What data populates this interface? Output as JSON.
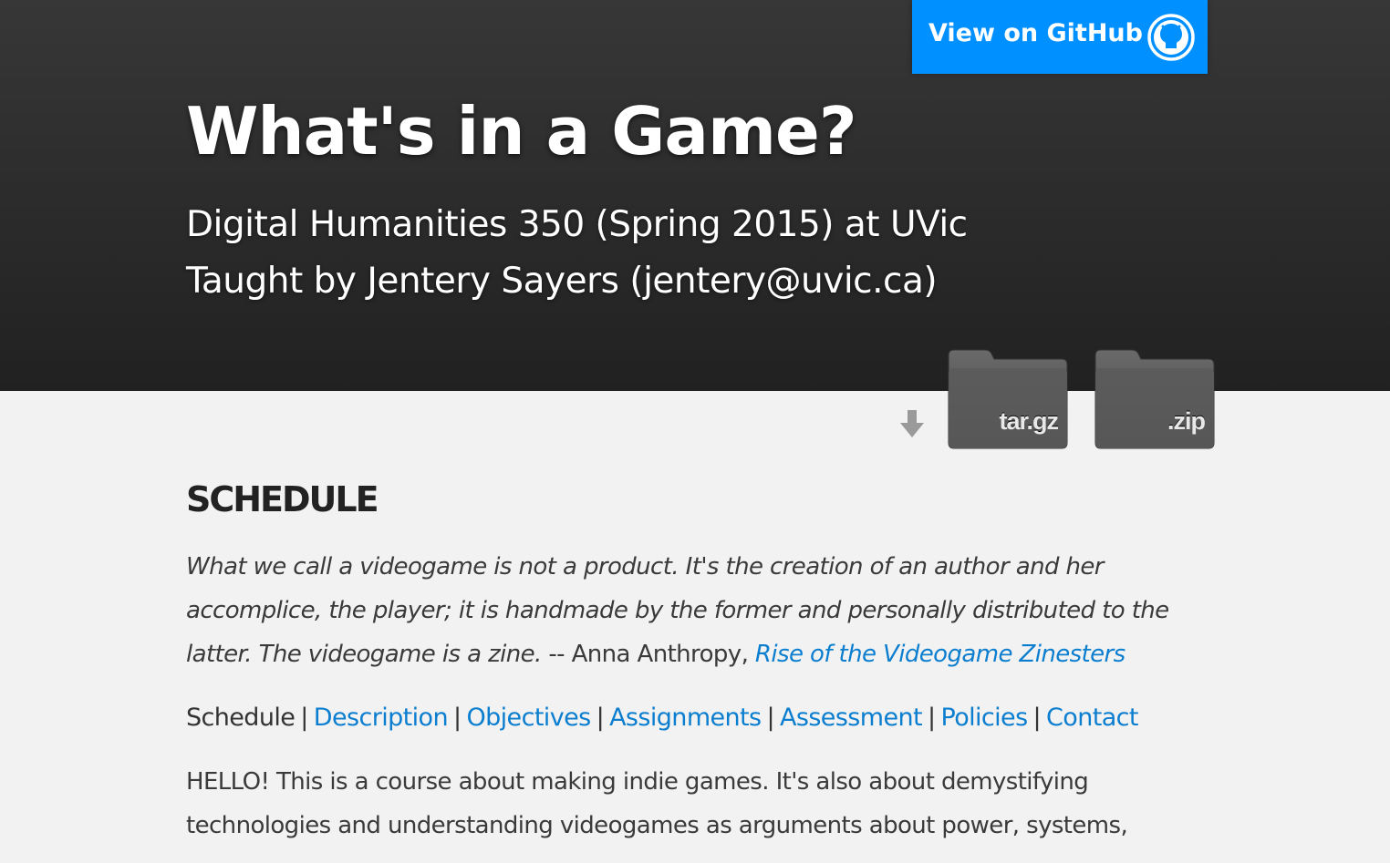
{
  "header": {
    "github_button_label": "View on GitHub",
    "github_icon": "github-octocat-icon",
    "title": "What's in a Game?",
    "subtitle_line1": "Digital Humanities 350 (Spring 2015) at UVic",
    "subtitle_line2": "Taught by Jentery Sayers (jentery@uvic.ca)"
  },
  "downloads": {
    "arrow_icon": "download-arrow-icon",
    "tar_label": "tar.gz",
    "zip_label": ".zip"
  },
  "main": {
    "heading": "SCHEDULE",
    "quote_text": "What we call a videogame is not a product. It's the creation of an author and her accomplice, the player; it is handmade by the former and personally distributed to the latter. The videogame is a zine.",
    "quote_attribution": " -- Anna Anthropy, ",
    "quote_link": "Rise of the Videogame Zinesters",
    "nav": {
      "current": "Schedule",
      "separator": "|",
      "links": [
        "Description",
        "Objectives",
        "Assignments",
        "Assessment",
        "Policies",
        "Contact"
      ]
    },
    "intro_text": "HELLO! This is a course about making indie games. It's also about demystifying technologies and understanding videogames as arguments about power, systems,"
  },
  "colors": {
    "header_top": "#373737",
    "header_bottom": "#212121",
    "github_button": "#0090ff",
    "link": "#0b7ecf",
    "page_bg": "#f2f2f2"
  }
}
